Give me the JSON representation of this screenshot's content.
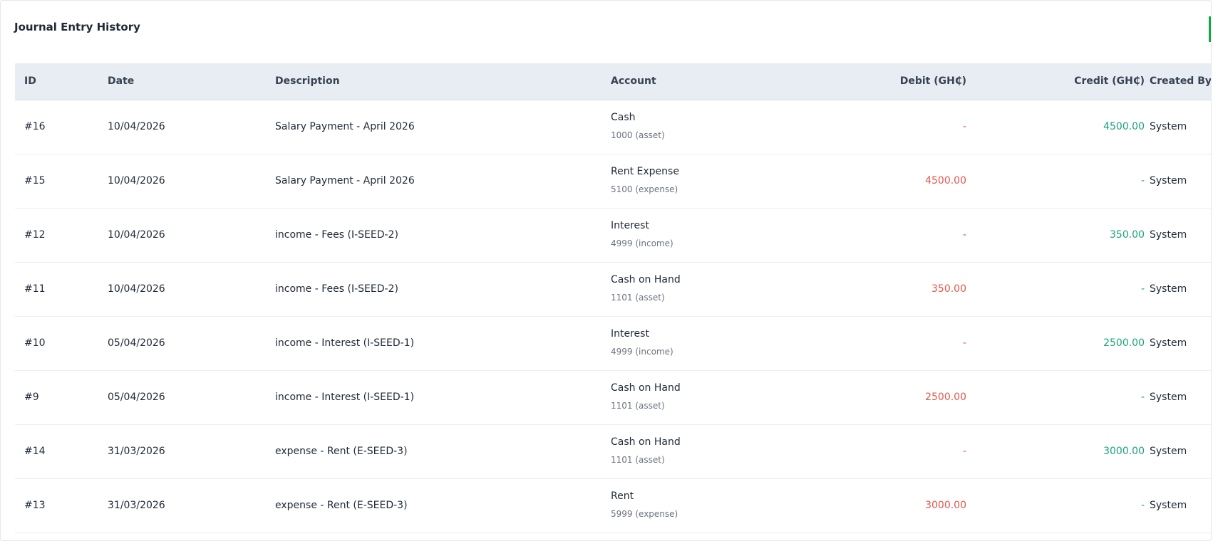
{
  "panel": {
    "title": "Journal Entry History"
  },
  "table": {
    "headers": {
      "id": "ID",
      "date": "Date",
      "description": "Description",
      "account": "Account",
      "debit": "Debit (GH₵)",
      "credit": "Credit (GH₵)",
      "created_by": "Created By"
    },
    "rows": [
      {
        "id": "#16",
        "date": "10/04/2026",
        "description": "Salary Payment - April 2026",
        "account": "Cash",
        "account_sub": "1000 (asset)",
        "debit": "-",
        "credit": "4500.00",
        "created_by": "System"
      },
      {
        "id": "#15",
        "date": "10/04/2026",
        "description": "Salary Payment - April 2026",
        "account": "Rent Expense",
        "account_sub": "5100 (expense)",
        "debit": "4500.00",
        "credit": "-",
        "created_by": "System"
      },
      {
        "id": "#12",
        "date": "10/04/2026",
        "description": "income - Fees (I-SEED-2)",
        "account": "Interest",
        "account_sub": "4999 (income)",
        "debit": "-",
        "credit": "350.00",
        "created_by": "System"
      },
      {
        "id": "#11",
        "date": "10/04/2026",
        "description": "income - Fees (I-SEED-2)",
        "account": "Cash on Hand",
        "account_sub": "1101 (asset)",
        "debit": "350.00",
        "credit": "-",
        "created_by": "System"
      },
      {
        "id": "#10",
        "date": "05/04/2026",
        "description": "income - Interest (I-SEED-1)",
        "account": "Interest",
        "account_sub": "4999 (income)",
        "debit": "-",
        "credit": "2500.00",
        "created_by": "System"
      },
      {
        "id": "#9",
        "date": "05/04/2026",
        "description": "income - Interest (I-SEED-1)",
        "account": "Cash on Hand",
        "account_sub": "1101 (asset)",
        "debit": "2500.00",
        "credit": "-",
        "created_by": "System"
      },
      {
        "id": "#14",
        "date": "31/03/2026",
        "description": "expense - Rent (E-SEED-3)",
        "account": "Cash on Hand",
        "account_sub": "1101 (asset)",
        "debit": "-",
        "credit": "3000.00",
        "created_by": "System"
      },
      {
        "id": "#13",
        "date": "31/03/2026",
        "description": "expense - Rent (E-SEED-3)",
        "account": "Rent",
        "account_sub": "5999 (expense)",
        "debit": "3000.00",
        "credit": "-",
        "created_by": "System"
      }
    ]
  },
  "colors": {
    "debit": "#e2574c",
    "credit": "#1aa37a",
    "header_bg": "#e8ecf3"
  }
}
